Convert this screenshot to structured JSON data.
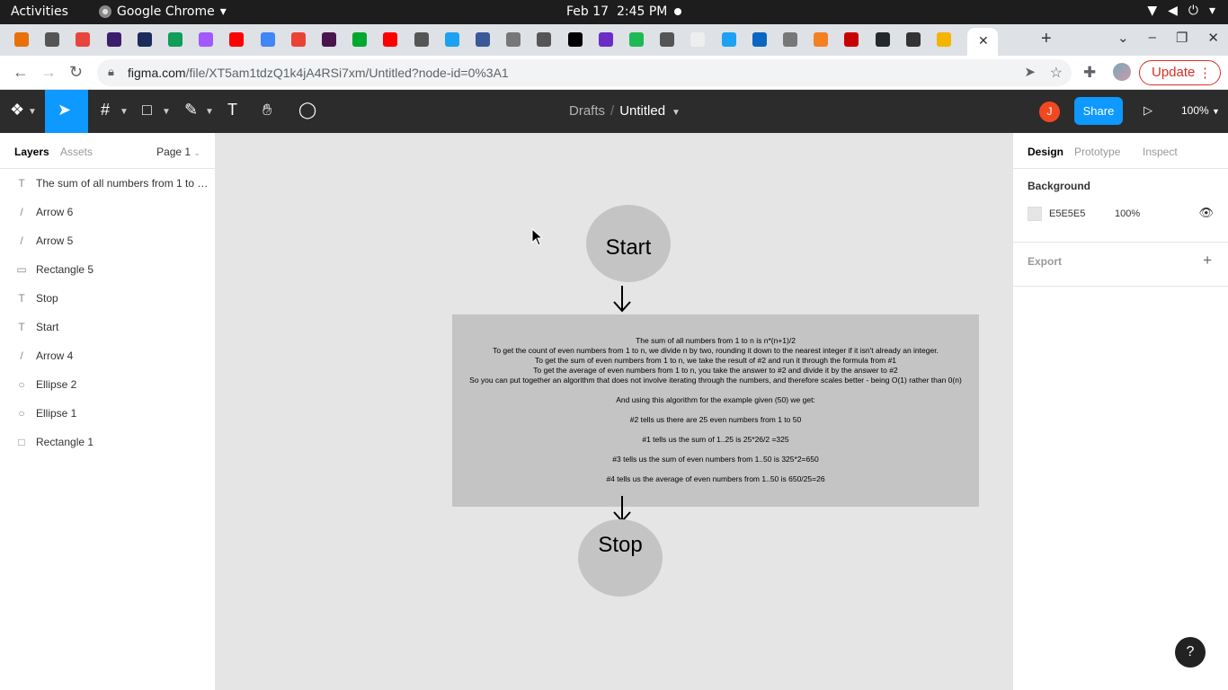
{
  "os_bar": {
    "activities": "Activities",
    "app_name": "Google Chrome",
    "date": "Feb 17",
    "time": "2:45 PM"
  },
  "browser": {
    "url_host": "figma.com",
    "url_path": "/file/XT5am1tdzQ1k4jA4RSi7xm/Untitled?node-id=0%3A1",
    "update_label": "Update",
    "tab_favicon_colors": [
      "#e8710a",
      "#555555",
      "#e8453c",
      "#3b1f6e",
      "#1a2b5c",
      "#0f9d58",
      "#a259ff",
      "#ff0000",
      "#4285f4",
      "#ea4335",
      "#4a154b",
      "#00a82d",
      "#ff0000",
      "#555555",
      "#1da1f2",
      "#3b5998",
      "#777777",
      "#555555",
      "#000000",
      "#6c2dc7",
      "#1db954",
      "#555555",
      "#eeeeee",
      "#1da1f2",
      "#0a66c2",
      "#777777",
      "#f48024",
      "#c90000",
      "#24292e",
      "#333333",
      "#f4b400"
    ]
  },
  "figma": {
    "breadcrumb_drafts": "Drafts",
    "file_title": "Untitled",
    "avatar_initial": "J",
    "share_label": "Share",
    "zoom_label": "100%"
  },
  "left_panel": {
    "tab_layers": "Layers",
    "tab_assets": "Assets",
    "page_label": "Page 1",
    "layers": [
      {
        "icon": "text-icon",
        "glyph": "T",
        "name": "The sum of all numbers from 1 to n..."
      },
      {
        "icon": "arrow-layer-icon",
        "glyph": "/",
        "name": "Arrow 6"
      },
      {
        "icon": "arrow-layer-icon",
        "glyph": "/",
        "name": "Arrow 5"
      },
      {
        "icon": "rectangle-icon",
        "glyph": "▭",
        "name": "Rectangle 5"
      },
      {
        "icon": "text-icon",
        "glyph": "T",
        "name": "Stop"
      },
      {
        "icon": "text-icon",
        "glyph": "T",
        "name": "Start"
      },
      {
        "icon": "arrow-layer-icon",
        "glyph": "/",
        "name": "Arrow 4"
      },
      {
        "icon": "ellipse-icon",
        "glyph": "○",
        "name": "Ellipse 2"
      },
      {
        "icon": "ellipse-icon",
        "glyph": "○",
        "name": "Ellipse 1"
      },
      {
        "icon": "rectangle-icon",
        "glyph": "□",
        "name": "Rectangle 1"
      }
    ]
  },
  "right_panel": {
    "tab_design": "Design",
    "tab_prototype": "Prototype",
    "tab_inspect": "Inspect",
    "background_title": "Background",
    "background_hex": "E5E5E5",
    "background_opacity": "100%",
    "export_title": "Export"
  },
  "canvas": {
    "start_label": "Start",
    "stop_label": "Stop",
    "text_lines": [
      "The sum of all numbers from 1 to n is n*(n+1)/2",
      "To get the count of even numbers from 1 to n, we divide n by two, rounding it down to the nearest integer if it isn't already an integer.",
      "To get the sum of even numbers from 1 to n, we take the result of #2 and run it through the formula from #1",
      "To get the average of even numbers from 1 to n, you take the answer to #2 and divide it by the answer to #2",
      "So you can put together an algorithm that does not involve iterating through the numbers, and therefore scales better - being O(1) rather than 0(n)",
      "",
      "And using this algorithm for the example given (50) we get:",
      "",
      "#2 tells us there are 25 even numbers from 1 to 50",
      "",
      "#1 tells us the sum of 1..25 is 25*26/2 =325",
      "",
      "#3 tells us the sum of even numbers from 1..50 is 325*2=650",
      "",
      "#4 tells us the average of even numbers from 1..50 is 650/25=26"
    ],
    "colors": {
      "canvas_bg": "#e5e5e5",
      "shape_fill": "#c4c4c4"
    }
  },
  "help_label": "?"
}
